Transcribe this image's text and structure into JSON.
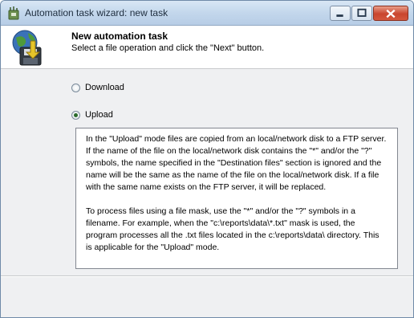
{
  "window": {
    "title": "Automation task wizard: new task",
    "app_icon": "wizard-app-icon",
    "controls": {
      "minimize_icon": "minimize-icon",
      "maximize_icon": "maximize-icon",
      "close_icon": "close-icon"
    }
  },
  "header": {
    "icon": "globe-disk-transfer-icon",
    "title": "New automation task",
    "subtitle": "Select a file operation and click the \"Next\" button."
  },
  "operations": [
    {
      "label": "Download",
      "selected": false
    },
    {
      "label": "Upload",
      "selected": true
    }
  ],
  "description": {
    "paragraph1": "In the \"Upload\" mode files are copied from an local/network disk to a FTP server. If the name of the file on the local/network disk contains the \"*\" and/or the \"?\" symbols, the name specified in the \"Destination files\" section is ignored and the name will be the same as the name of the file on the local/network disk. If a file with the same name exists on the FTP server, it will be replaced.",
    "paragraph2": "To process files using a file mask, use the \"*\" and/or the \"?\" symbols in a filename. For example, when the \"c:\\reports\\data\\*.txt\" mask is used, the program processes all the .txt files located in the c:\\reports\\data\\ directory. This is applicable for the \"Upload\" mode."
  }
}
